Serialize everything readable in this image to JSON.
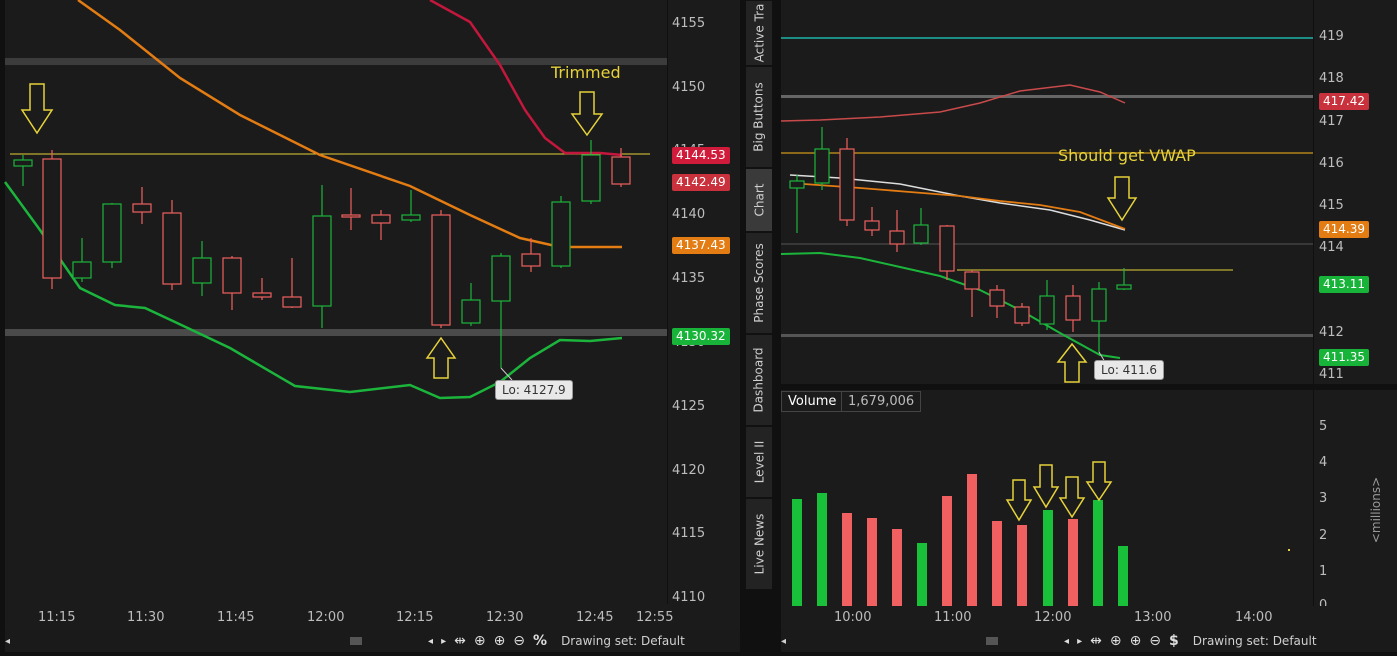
{
  "left_chart": {
    "y_ticks": [
      "4155",
      "4150",
      "4145",
      "4140",
      "4135",
      "4130",
      "4125",
      "4120",
      "4115",
      "4110"
    ],
    "x_ticks": [
      "11:15",
      "11:30",
      "11:45",
      "12:00",
      "12:15",
      "12:30",
      "12:45",
      "12:55"
    ],
    "price_tags": [
      {
        "value": "4144.53",
        "color": "#d11b3b"
      },
      {
        "value": "4142.49",
        "color": "#c9323c"
      },
      {
        "value": "4137.43",
        "color": "#e27c13"
      },
      {
        "value": "4130.32",
        "color": "#18b43a"
      }
    ],
    "annotation_note": "Trimmed",
    "low_callout": "Lo: 4127.9",
    "toolbar": {
      "drawing_set": "Drawing set: Default"
    }
  },
  "right_chart": {
    "y_ticks": [
      "419",
      "418",
      "417",
      "416",
      "415",
      "414",
      "413",
      "412",
      "411"
    ],
    "price_tags": [
      {
        "value": "417.42",
        "color": "#c9323c"
      },
      {
        "value": "414.39",
        "color": "#e27c13"
      },
      {
        "value": "413.11",
        "color": "#18b43a"
      },
      {
        "value": "411.35",
        "color": "#18b43a"
      }
    ],
    "annotation_note": "Should get VWAP",
    "low_callout": "Lo: 411.6",
    "volume": {
      "label": "Volume",
      "value": "1,679,006",
      "y_ticks": [
        "5",
        "4",
        "3",
        "2",
        "1",
        "0"
      ],
      "unit": "<millions>",
      "x_ticks": [
        "10:00",
        "11:00",
        "12:00",
        "13:00",
        "14:00"
      ]
    },
    "toolbar": {
      "drawing_set": "Drawing set: Default"
    }
  },
  "side_tabs": [
    {
      "label": "Active Tra",
      "active": false
    },
    {
      "label": "Big Buttons",
      "active": false
    },
    {
      "label": "Chart",
      "active": true
    },
    {
      "label": "Phase Scores",
      "active": false
    },
    {
      "label": "Dashboard",
      "active": false
    },
    {
      "label": "Level II",
      "active": false
    },
    {
      "label": "Live News",
      "active": false
    }
  ]
}
